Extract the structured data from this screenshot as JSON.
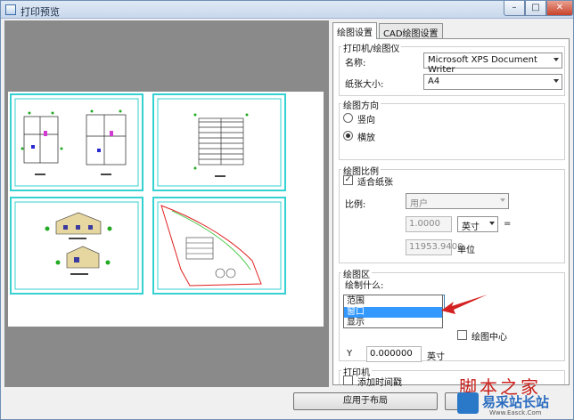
{
  "window": {
    "title": "打印预览",
    "min": "–",
    "max": "□",
    "close": "✕"
  },
  "tabs": [
    {
      "label": "绘图设置",
      "active": true
    },
    {
      "label": "CAD绘图设置",
      "active": false
    }
  ],
  "printer_group": {
    "title": "打印机/绘图仪",
    "name_label": "名称:",
    "name_value": "Microsoft XPS Document Writer",
    "paper_label": "纸张大小:",
    "paper_value": "A4"
  },
  "orientation_group": {
    "title": "绘图方向",
    "portrait": "竖向",
    "landscape": "横放",
    "selected": "landscape"
  },
  "scale_group": {
    "title": "绘图比例",
    "fit_label": "适合纸张",
    "fit_checked": true,
    "scale_label": "比例:",
    "scale_value": "用户",
    "value1": "1.0000",
    "unit_value": "英寸",
    "equals": "=",
    "value2": "11953.9400",
    "unit_label": "单位"
  },
  "area_group": {
    "title": "绘图区",
    "what_label": "绘制什么:",
    "selected": "范围",
    "options": [
      "范围",
      "窗口",
      "显示"
    ],
    "highlighted_option": "窗口",
    "center_label": "绘图中心",
    "y_label": "Y",
    "y_value": "0.000000",
    "y_unit": "英寸"
  },
  "print_group": {
    "title": "打印机",
    "timestamp_label": "添加时间戳"
  },
  "footer": {
    "apply_button": "应用于布局"
  },
  "watermark": {
    "line1": "脚本之家",
    "line2": "易采站长站",
    "line3": "Www.Easck.Com"
  },
  "colors": {
    "sheet_border": "#36d1d1",
    "preview_bg": "#8a8a8a",
    "highlight": "#3399ff",
    "pointer": "#d42020"
  }
}
